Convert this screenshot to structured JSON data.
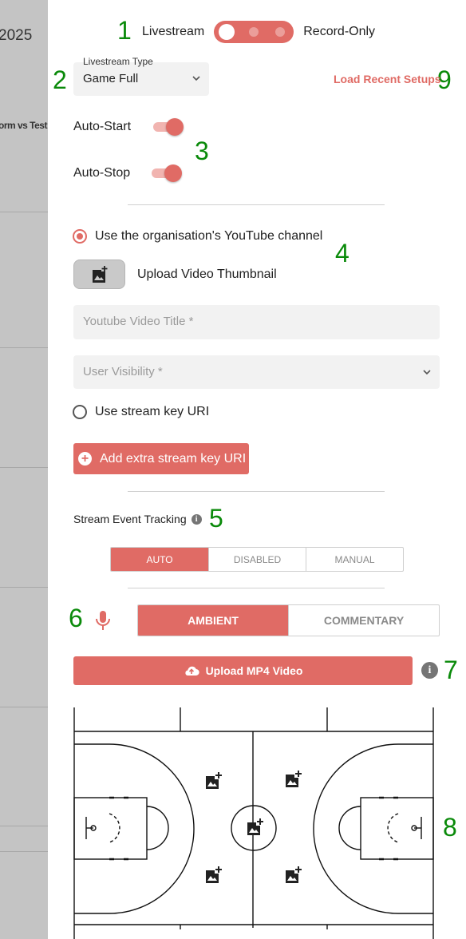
{
  "background": {
    "year_fragment": "2025",
    "match_fragment": "orm vs Test"
  },
  "markers": [
    "1",
    "2",
    "3",
    "4",
    "5",
    "6",
    "7",
    "8",
    "9"
  ],
  "mode": {
    "left_label": "Livestream",
    "right_label": "Record-Only",
    "position": "left"
  },
  "livestream_type": {
    "label": "Livestream Type",
    "value": "Game Full"
  },
  "load_recent_label": "Load Recent Setups",
  "auto_start": {
    "label": "Auto-Start",
    "on": true
  },
  "auto_stop": {
    "label": "Auto-Stop",
    "on": true
  },
  "youtube": {
    "option_label": "Use the organisation's YouTube channel",
    "selected": true,
    "thumbnail_label": "Upload Video Thumbnail",
    "title_placeholder": "Youtube Video Title *",
    "visibility_placeholder": "User Visibility *"
  },
  "stream_key": {
    "option_label": "Use stream key URI",
    "selected": false,
    "add_label": "Add extra stream key URI"
  },
  "event_tracking": {
    "label": "Stream Event Tracking",
    "options": [
      "AUTO",
      "DISABLED",
      "MANUAL"
    ],
    "selected": "AUTO"
  },
  "audio": {
    "options": [
      "AMBIENT",
      "COMMENTARY"
    ],
    "selected": "AMBIENT"
  },
  "upload_mp4_label": "Upload MP4 Video",
  "colors": {
    "accent": "#e06b65",
    "marker": "#0a8a0a"
  }
}
